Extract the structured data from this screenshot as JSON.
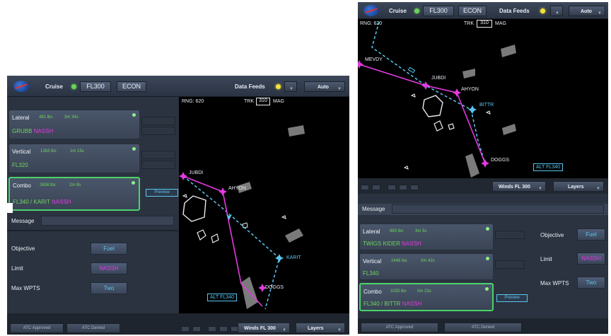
{
  "colors": {
    "magenta": "#e23ae0",
    "cyan": "#58c6ef",
    "green": "#6fd45f",
    "combo_border": "#4bd36a",
    "map_bg": "#000000"
  },
  "icons": [
    "nasa-logo",
    "status-dot-green",
    "status-dot-yellow",
    "chevron-down-icon",
    "waypoint-icon",
    "aircraft-icon"
  ],
  "left": {
    "topbar": {
      "logo": "NASA",
      "mode": "Cruise",
      "altitude": "FL300",
      "speed": "ECON",
      "data_feeds": "Data Feeds",
      "auto": "Auto"
    },
    "cards": {
      "lateral": {
        "title": "Lateral",
        "stat1": "481 lbs",
        "stat2": "3m 34s",
        "route_green": "GRUBB",
        "route_mag": "NASSH"
      },
      "vertical": {
        "title": "Vertical",
        "stat1": "1363 lbs",
        "stat2": "1m 15s",
        "route_green": "FL320"
      },
      "combo": {
        "title": "Combo",
        "stat1": "2608 lbs",
        "stat2": "2m 8s",
        "route_green": "FL340 / KARIT",
        "route_mag": "NASSH"
      }
    },
    "preview": "Preview",
    "message_label": "Message",
    "settings": {
      "objective_label": "Objective",
      "objective_value": "Fuel",
      "limit_label": "Limit",
      "limit_value": "NASSH",
      "maxwpts_label": "Max WPTS",
      "maxwpts_value": "Two"
    },
    "map": {
      "range": "RNG: 620",
      "trk": "TRK",
      "trk_value": "310",
      "mag": "MAG",
      "waypoints": [
        "JUBDI",
        "AHYON",
        "KARIT",
        "DOGGS"
      ],
      "alt_label": "ALT FL340"
    },
    "bottom": {
      "atc_approved": "ATC Approved",
      "atc_denied": "ATC Denied",
      "winds": "Winds FL 300",
      "layers": "Layers"
    }
  },
  "right": {
    "topbar": {
      "logo": "NASA",
      "mode": "Cruise",
      "altitude": "FL300",
      "speed": "ECON",
      "data_feeds": "Data Feeds",
      "auto": "Auto"
    },
    "map": {
      "range": "RNG: 620",
      "trk": "TRK",
      "trk_value": "310",
      "mag": "MAG",
      "waypoints": [
        "MEVDY",
        "JUBDI",
        "AHYON",
        "BITTR",
        "DOGGS"
      ],
      "alt_label": "ALT FL340"
    },
    "mid": {
      "winds": "Winds FL 300",
      "layers": "Layers"
    },
    "message_label": "Message",
    "cards": {
      "lateral": {
        "title": "Lateral",
        "stat1": "883 lbs",
        "stat2": "3m 5s",
        "route_green": "TWIGS KIDER",
        "route_mag": "NASSH"
      },
      "vertical": {
        "title": "Vertical",
        "stat1": "2446 lbs",
        "stat2": "0m 42s",
        "route_green": "FL340"
      },
      "combo": {
        "title": "Combo",
        "stat1": "3150 lbs",
        "stat2": "0m 23s",
        "route_green": "FL340 / BITTR",
        "route_mag": "NASSH"
      }
    },
    "preview": "Preview",
    "settings": {
      "objective_label": "Objective",
      "objective_value": "Fuel",
      "limit_label": "Limit",
      "limit_value": "NASSH",
      "maxwpts_label": "Max WPTS",
      "maxwpts_value": "Two"
    },
    "bottom": {
      "atc_approved": "ATC Approved",
      "atc_denied": "ATC Denied"
    }
  }
}
